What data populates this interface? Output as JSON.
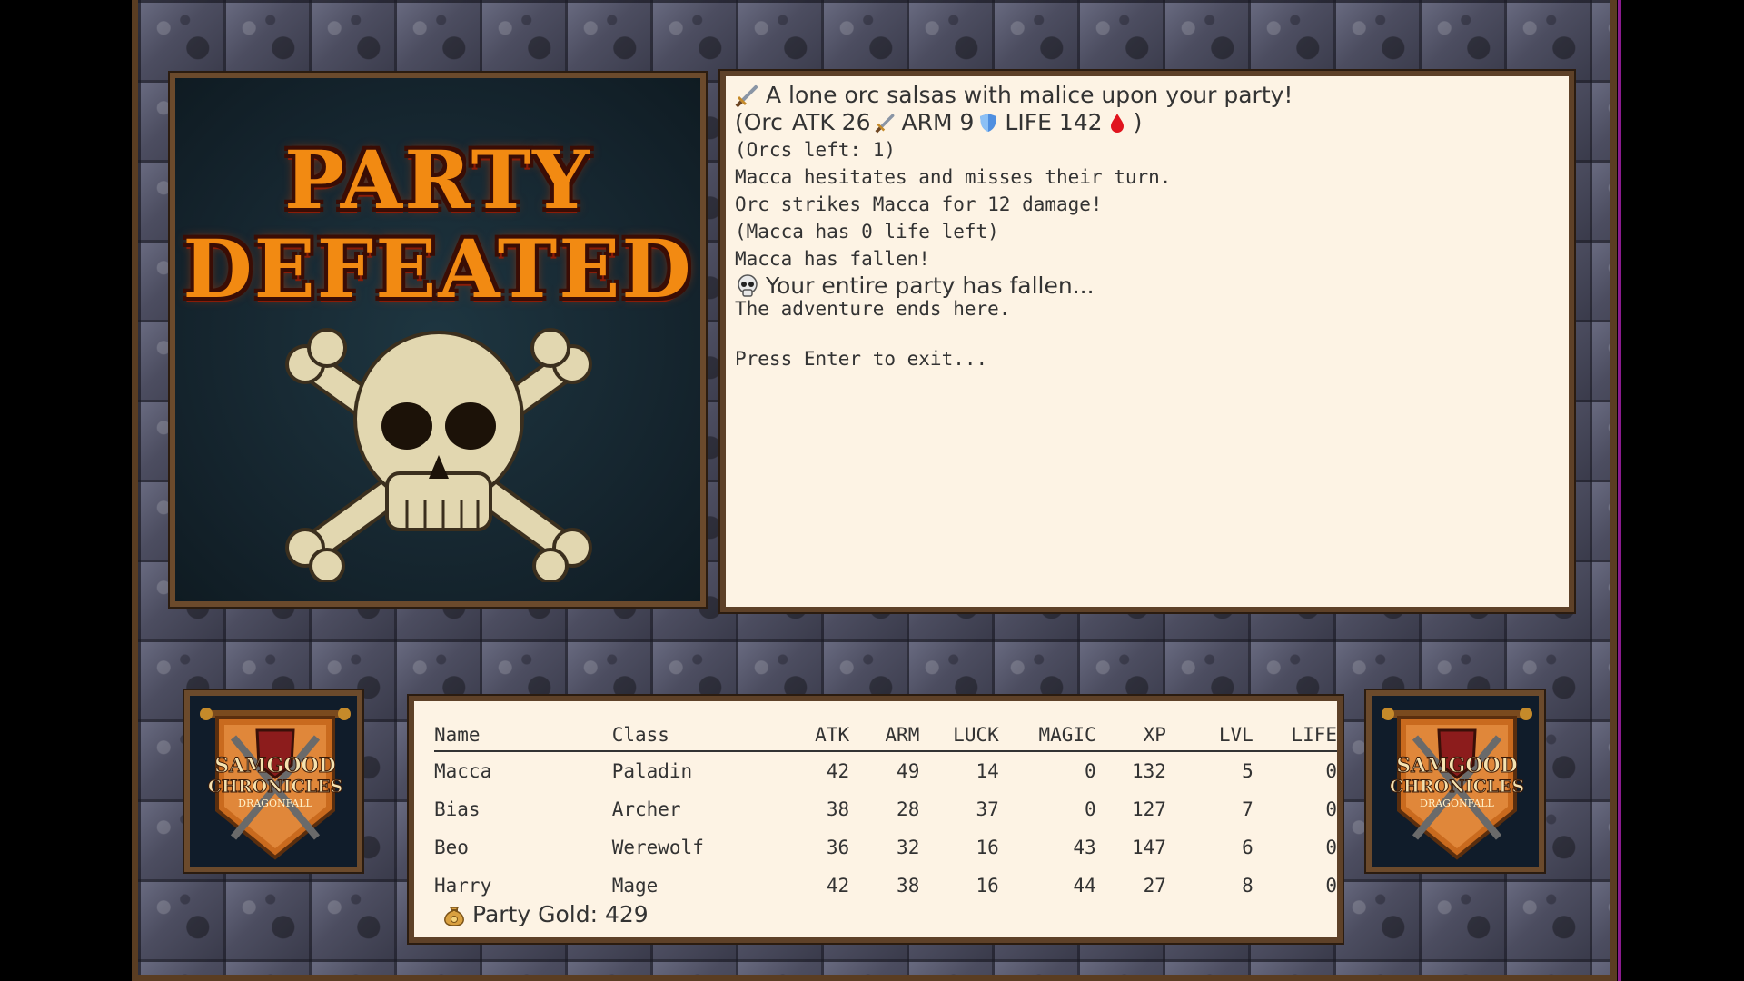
{
  "defeat": {
    "line1": "PARTY",
    "line2": "DEFEATED"
  },
  "log": {
    "encounter": "A lone orc salsas with malice upon your party!",
    "orc_open": "(Orc",
    "atk_label": "ATK 26",
    "arm_label": "ARM 9",
    "life_label": "LIFE 142",
    "orc_close": ")",
    "orcs_left": "(Orcs left: 1)",
    "line_hesitate": "Macca hesitates and misses their turn.",
    "line_strike": "Orc strikes Macca for 12 damage!",
    "line_life": "(Macca has 0 life left)",
    "line_fallen": "Macca has fallen!",
    "party_fallen": "Your entire party has fallen...",
    "adventure_ends": "The adventure ends here.",
    "prompt": "Press Enter to exit..."
  },
  "banner": {
    "line1": "SAMGOOD",
    "line2": "CHRONICLES",
    "line3": "DRAGONFALL"
  },
  "stats": {
    "headers": {
      "name": "Name",
      "class": "Class",
      "atk": "ATK",
      "arm": "ARM",
      "luck": "LUCK",
      "magic": "MAGIC",
      "xp": "XP",
      "lvl": "LVL",
      "life": "LIFE"
    },
    "rows": [
      {
        "name": "Macca",
        "class": "Paladin",
        "atk": "42",
        "arm": "49",
        "luck": "14",
        "magic": "0",
        "xp": "132",
        "lvl": "5",
        "life": "0"
      },
      {
        "name": "Bias",
        "class": "Archer",
        "atk": "38",
        "arm": "28",
        "luck": "37",
        "magic": "0",
        "xp": "127",
        "lvl": "7",
        "life": "0"
      },
      {
        "name": "Beo",
        "class": "Werewolf",
        "atk": "36",
        "arm": "32",
        "luck": "16",
        "magic": "43",
        "xp": "147",
        "lvl": "6",
        "life": "0"
      },
      {
        "name": "Harry",
        "class": "Mage",
        "atk": "42",
        "arm": "38",
        "luck": "16",
        "magic": "44",
        "xp": "27",
        "lvl": "8",
        "life": "0"
      }
    ],
    "gold_label": "Party Gold: 429"
  },
  "icons": {
    "sword": "sword-icon",
    "shield": "shield-icon",
    "blood": "blood-drop-icon",
    "skull": "skull-icon",
    "gold": "money-bag-icon"
  },
  "colors": {
    "panel_bg": "#fdf3e4",
    "frame_border": "#5a3d22",
    "defeat_text": "#f28a12",
    "defeat_bg": "#14232c",
    "shield_blue": "#4f8fe0",
    "blood_red": "#e0141e"
  }
}
